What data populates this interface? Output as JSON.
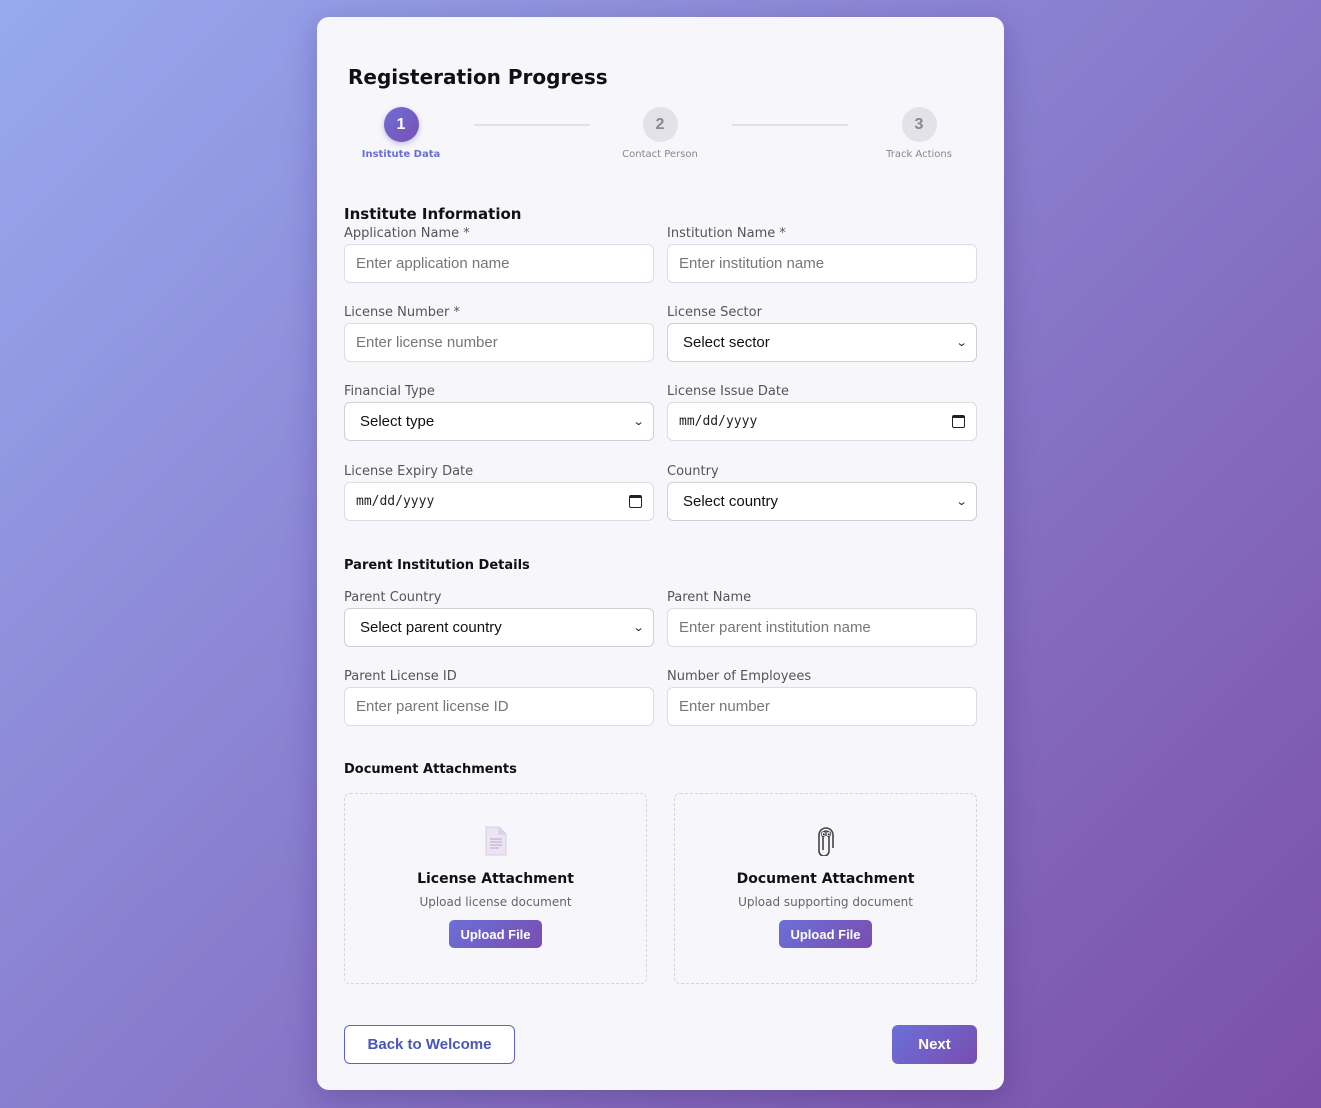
{
  "progress": {
    "title": "Registeration Progress",
    "steps": [
      {
        "number": "1",
        "label": "Institute Data",
        "state": "active"
      },
      {
        "number": "2",
        "label": "Contact Person",
        "state": "inactive"
      },
      {
        "number": "3",
        "label": "Track Actions",
        "state": "inactive"
      }
    ]
  },
  "institute": {
    "title": "Institute Information",
    "application_name": {
      "label": "Application Name *",
      "placeholder": "Enter application name"
    },
    "institution_name": {
      "label": "Institution Name *",
      "placeholder": "Enter institution name"
    },
    "license_number": {
      "label": "License Number *",
      "placeholder": "Enter license number"
    },
    "license_sector": {
      "label": "License Sector",
      "value": "Select sector"
    },
    "financial_type": {
      "label": "Financial Type",
      "value": "Select type"
    },
    "license_issue_date": {
      "label": "License Issue Date",
      "value": "mm/dd/yyyy"
    },
    "license_expiry_date": {
      "label": "License Expiry Date",
      "value": "mm/dd/yyyy"
    },
    "country": {
      "label": "Country",
      "value": "Select country"
    }
  },
  "parent": {
    "title": "Parent Institution Details",
    "parent_country": {
      "label": "Parent Country",
      "value": "Select parent country"
    },
    "parent_name": {
      "label": "Parent Name",
      "placeholder": "Enter parent institution name"
    },
    "parent_license_id": {
      "label": "Parent License ID",
      "placeholder": "Enter parent license ID"
    },
    "employees": {
      "label": "Number of Employees",
      "placeholder": "Enter number"
    }
  },
  "attachments": {
    "title": "Document Attachments",
    "license": {
      "icon": "document-icon",
      "title": "License Attachment",
      "desc": "Upload license document",
      "button": "Upload File"
    },
    "document": {
      "icon": "paperclip-icon",
      "title": "Document Attachment",
      "desc": "Upload supporting document",
      "button": "Upload File"
    }
  },
  "footer": {
    "back_label": "Back to Welcome",
    "next_label": "Next"
  },
  "colors": {
    "accent": "#6a70d8",
    "accent_dark": "#7a4db0"
  }
}
